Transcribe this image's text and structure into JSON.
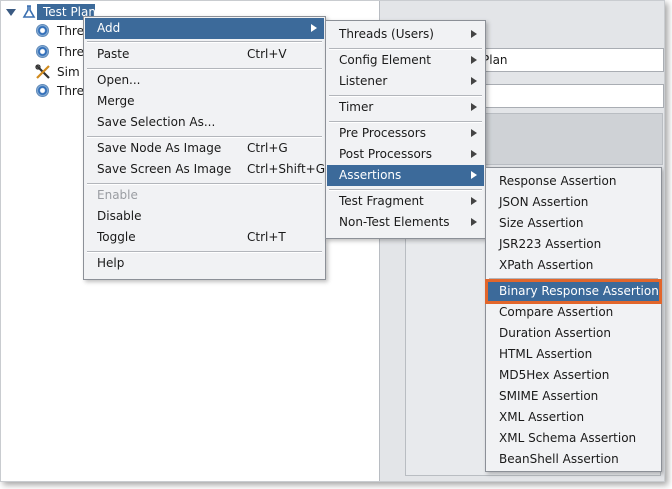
{
  "tree": {
    "root_label": "Test Plan",
    "children": [
      {
        "label": "Thre",
        "icon": "gear-icon"
      },
      {
        "label": "Thre",
        "icon": "gear-icon"
      },
      {
        "label": "Sim",
        "icon": "tools-icon"
      },
      {
        "label": "Thre",
        "icon": "gear-icon"
      }
    ]
  },
  "props": {
    "name_value": "Plan"
  },
  "context_menu": {
    "items": [
      {
        "label": "Add",
        "shortcut": "",
        "submenu": true
      },
      {
        "label": "Paste",
        "shortcut": "Ctrl+V"
      },
      {
        "label": "Open..."
      },
      {
        "label": "Merge"
      },
      {
        "label": "Save Selection As..."
      },
      {
        "label": "Save Node As Image",
        "shortcut": "Ctrl+G"
      },
      {
        "label": "Save Screen As Image",
        "shortcut": "Ctrl+Shift+G"
      },
      {
        "label": "Enable",
        "disabled": true
      },
      {
        "label": "Disable"
      },
      {
        "label": "Toggle",
        "shortcut": "Ctrl+T"
      },
      {
        "label": "Help"
      }
    ]
  },
  "add_menu": {
    "items": [
      {
        "label": "Threads (Users)"
      },
      {
        "label": "Config Element"
      },
      {
        "label": "Listener"
      },
      {
        "label": "Timer"
      },
      {
        "label": "Pre Processors"
      },
      {
        "label": "Post Processors"
      },
      {
        "label": "Assertions"
      },
      {
        "label": "Test Fragment"
      },
      {
        "label": "Non-Test Elements"
      }
    ]
  },
  "assertions_menu": {
    "items": [
      "Response Assertion",
      "JSON Assertion",
      "Size Assertion",
      "JSR223 Assertion",
      "XPath Assertion",
      "Binary Response Assertion",
      "Compare Assertion",
      "Duration Assertion",
      "HTML Assertion",
      "MD5Hex Assertion",
      "SMIME Assertion",
      "XML Assertion",
      "XML Schema Assertion",
      "BeanShell Assertion"
    ]
  },
  "colors": {
    "highlight": "#3c6a9a",
    "callout": "#e2662b"
  }
}
